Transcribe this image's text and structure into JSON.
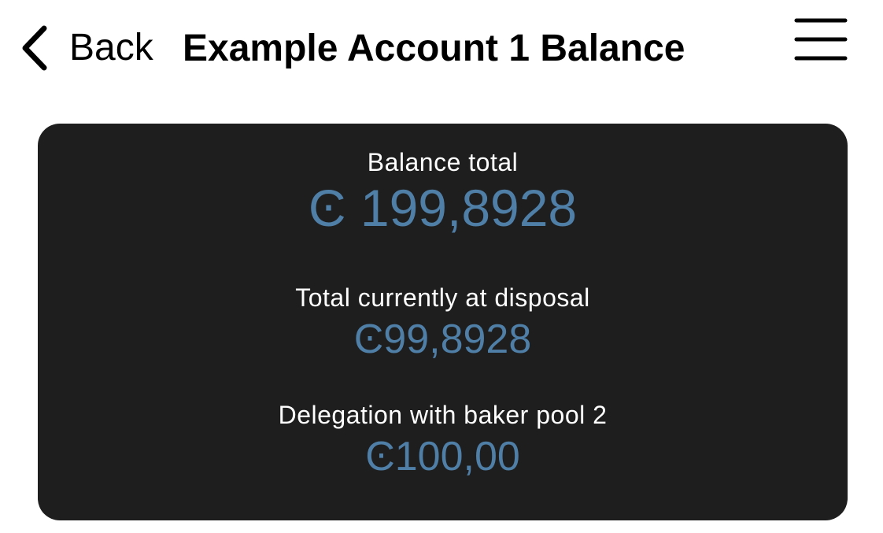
{
  "header": {
    "back_label": "Back",
    "title": "Example Account 1 Balance"
  },
  "balance": {
    "total_label": "Balance total",
    "total_value": "Ͼ 199,8928",
    "disposal_label": "Total currently at disposal",
    "disposal_value": "Ͼ99,8928",
    "delegation_label": "Delegation with baker pool 2",
    "delegation_value": "Ͼ100,00"
  },
  "colors": {
    "card_background": "#1e1e1e",
    "accent": "#4f7ea6",
    "label_text": "#ffffff"
  },
  "icons": {
    "back": "chevron-left-icon",
    "menu": "hamburger-menu-icon"
  }
}
